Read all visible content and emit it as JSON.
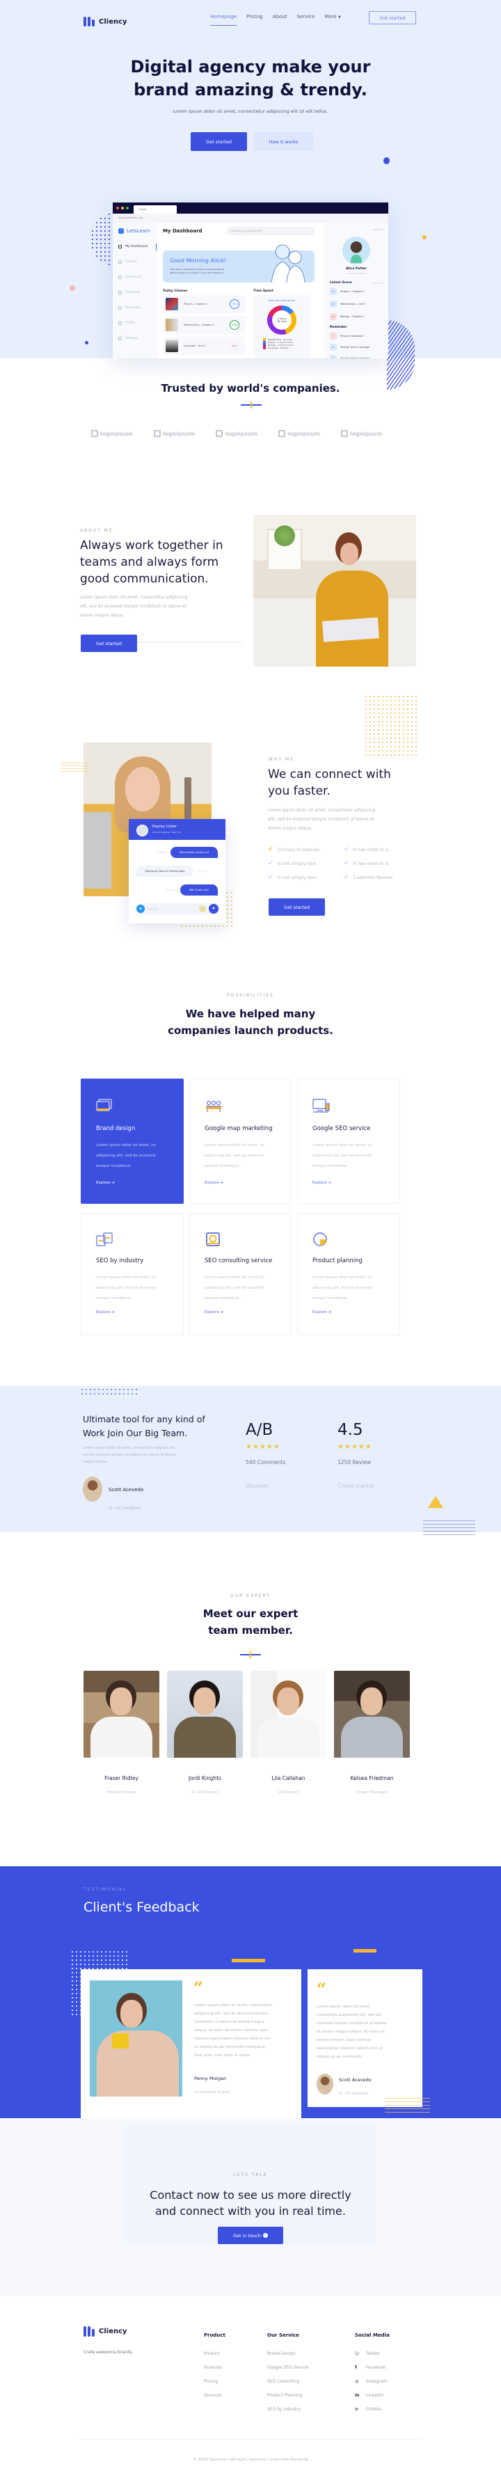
{
  "brand": {
    "name": "Cliency",
    "accent": "#3b50df",
    "gold": "#f5b82e"
  },
  "nav": {
    "items": [
      "Homepage",
      "Pricing",
      "About",
      "Service",
      "More"
    ],
    "active": "Homepage",
    "cta": "Get started"
  },
  "hero": {
    "title_line1": "Digital agency make your",
    "title_line2": "brand amazing & trendy.",
    "subtitle": "Lorem ipsum dolor sit amet, consectetur adipiscing elit Ut elit tellus.",
    "primary_btn": "Get started",
    "secondary_btn": "How it works"
  },
  "dashboard": {
    "tab_title": "Portal",
    "url": "https://letslearn.com",
    "app_name": "LetsLearn",
    "page_title": "My Dashboard",
    "search_placeholder": "What are you looking for?",
    "logout": "Log Out",
    "sidebar": [
      "My Dashboard",
      "Classes",
      "Resources",
      "Schedule",
      "Messages",
      "Profile",
      "Settings"
    ],
    "greeting": "Good Morning Alice!",
    "quote_line1": "\"Education is the ability to listen to almost anything",
    "quote_line2": "without losing your temper or your self-confidence.\"",
    "today_classes_label": "Today Classes",
    "classes": [
      {
        "name": "Physics - Chapter 3",
        "progress": "75%"
      },
      {
        "name": "Mathematics - Chapter 4",
        "progress": "100%"
      },
      {
        "name": "Language - Unit 2",
        "progress": "20%"
      }
    ],
    "time_spent_label": "Time Spent",
    "time_spent_note": "Good job, keep going!",
    "time_total_line1": "4 hours",
    "time_total_line2": "38 mins",
    "time_legend": [
      {
        "label": "Mathematics - 40 mins",
        "color": "#f5b600"
      },
      {
        "label": "Physics - 1 hours 2 mins",
        "color": "#2f80ed"
      },
      {
        "label": "Biology - 2 hours 5 mins",
        "color": "#8a2be2"
      },
      {
        "label": "Language - 40 mins",
        "color": "#e0245e"
      }
    ],
    "user_name": "Alice Potter",
    "user_role": "Student Grade 8",
    "latest_score_label": "Latest Score",
    "view_all": "View all",
    "scores": [
      {
        "score": "8.5",
        "subject": "Physics - Chapter 3"
      },
      {
        "score": "9.5",
        "subject": "Mathematics - Unit 3"
      },
      {
        "score": "5.0",
        "subject": "Biology - Chapter 4"
      }
    ],
    "reminder_label": "Reminder",
    "reminders": [
      "Physics Homework",
      "Teacher Amy's message",
      "Teacher James message"
    ]
  },
  "trusted": {
    "title": "Trusted by world's companies.",
    "logos": [
      "logoipsum",
      "logoipsum",
      "logoipsum",
      "logoipsum",
      "logoipsum"
    ]
  },
  "about": {
    "eyebrow": "ABOUT ME",
    "title_lines": [
      "Always work together in",
      "teams and always form",
      "good communication."
    ],
    "text_lines": [
      "Lorem ipsum dolor sit amet, consectetur adipiscing",
      "elit, sed do eiusmod tempor incididunt ut labore et",
      "dolore magna aliqua."
    ],
    "cta": "Get started"
  },
  "why": {
    "eyebrow": "WHY ME",
    "title_lines": [
      "We can connect with",
      "you faster."
    ],
    "text_lines": [
      "Lorem ipsum dolor sit amet, consectetur adipiscing",
      "elit, sed do eiusmod tempor incididunt ut labore et",
      "dolore magna aliqua."
    ],
    "checks": [
      "Contary to popular",
      "It has roots in a",
      "is not simply text.",
      "It has roots in a",
      "Is not simply text.",
      "Customer Review"
    ],
    "cta": "Get started",
    "chat": {
      "name": "Kayley Lister",
      "role": "Product Designer, New York",
      "messages": [
        {
          "from": "me",
          "text": "Hello Kayley! what's up?",
          "time": "08:30 am"
        },
        {
          "from": "them",
          "text": "Staying at home & Feeling Good",
          "time": "08:32 am"
        },
        {
          "from": "me",
          "text": "Well Thats Cool!",
          "time": "08:35 am"
        }
      ],
      "input_placeholder": "Type here"
    }
  },
  "services": {
    "eyebrow": "POSSIBILITIES",
    "title_line1": "We have helped many",
    "title_line2": "companies launch products.",
    "text_line1": "Lorem ipsum dolor sit amet, co",
    "text_line2": "adipiscing elit, sed do eiusmod",
    "text_line3": "tempor incididunt.",
    "explore": "Explore",
    "cards": [
      {
        "title": "Brand design",
        "icon": "browser-windows-icon",
        "highlight": true
      },
      {
        "title": "Google map marketing",
        "icon": "team-meeting-icon",
        "highlight": false
      },
      {
        "title": "Google SEO service",
        "icon": "desktop-mobile-icon",
        "highlight": false
      },
      {
        "title": "SEO by industry",
        "icon": "devices-icon",
        "highlight": false
      },
      {
        "title": "SEO consulting service",
        "icon": "safe-icon",
        "highlight": false
      },
      {
        "title": "Product planning",
        "icon": "pie-chart-icon",
        "highlight": false
      }
    ]
  },
  "stats": {
    "title_line1": "Ultimate tool for any kind of",
    "title_line2": "Work Join Our Big Team.",
    "text_lines": [
      "Lorem ipsum dolor sit amet, consectetur adipisci elit,",
      "sed do eiusmod tempor incididunt ut labore et dolore",
      "magna aliqua."
    ],
    "person_name": "Scott Acevedo",
    "person_role": "Sr. UX Designer",
    "items": [
      {
        "value": "A/B",
        "rating": 5,
        "count": "540 Comments",
        "link": "Discover"
      },
      {
        "value": "4.5",
        "rating": 5,
        "count": "1250 Review",
        "link": "Cheak market"
      }
    ]
  },
  "team": {
    "eyebrow": "OUR EXPERT",
    "title_line1": "Meet our expert",
    "title_line2": "team member.",
    "members": [
      {
        "name": "Fraser Ridley",
        "role": "Head of design"
      },
      {
        "name": "Jordi Knights",
        "role": "Sr. UX Design"
      },
      {
        "name": "Lila Callahan",
        "role": "UI Desiner"
      },
      {
        "name": "Kelsea Friedman",
        "role": "Project Manager"
      }
    ]
  },
  "testimonial": {
    "eyebrow": "TESTIMONIAL",
    "title": "Client's Feedback",
    "items": [
      {
        "text_lines": [
          "Lorem ipsum dolor sit amet, consectetur",
          "adipiscing elit, sed do eiusmod tempor",
          "incididunt ut labore et dolore magna",
          "aliqua. Ut enim ad minim veniam, quis",
          "nostrud exercitation ullamco laboris nisi",
          "ut aliquip ex ea commodo consequat.",
          "Duis aute irure dolor in repre."
        ],
        "name": "Penny Morgan",
        "role": "UI Designer Expert"
      },
      {
        "text_lines": [
          "Lorem ipsum dolor sit amet,",
          "consectetu adipiscing elit, sed do",
          "eiusmod tempor incididunt ut labore",
          "et dolore magna aliqua. Ut enim ad",
          "minim veniam, quis nostrud",
          "exercitation ullamco laboris nisi ut",
          "aliquip ex ea commodo."
        ],
        "name": "Scott Acevedo",
        "role": "Sr. UX Designer"
      }
    ]
  },
  "contact": {
    "eyebrow": "LETS TALK",
    "title_line1": "Contact now to see us more directly",
    "title_line2": "and connect with you in real time.",
    "cta": "Get in touch"
  },
  "footer": {
    "tagline": "Crate awesome brands.",
    "columns": [
      {
        "title": "Product",
        "links": [
          "Product",
          "Features",
          "Pricing",
          "Services"
        ]
      },
      {
        "title": "Our Service",
        "links": [
          "Brand Design",
          "Google SEO Service",
          "SEO Consulting",
          "Product Planning",
          "SEO by Industry"
        ]
      }
    ],
    "social_title": "Social Media",
    "social": [
      {
        "label": "Twitter",
        "icon": "twitter-icon"
      },
      {
        "label": "Facebook",
        "icon": "facebook-icon"
      },
      {
        "label": "Instagram",
        "icon": "instagram-icon"
      },
      {
        "label": "Linkedin",
        "icon": "linkedin-icon"
      },
      {
        "label": "Dribble",
        "icon": "dribbble-icon"
      }
    ],
    "copyright": "© 2020 Takamoo • All rights reserved • Love from Bandung"
  }
}
